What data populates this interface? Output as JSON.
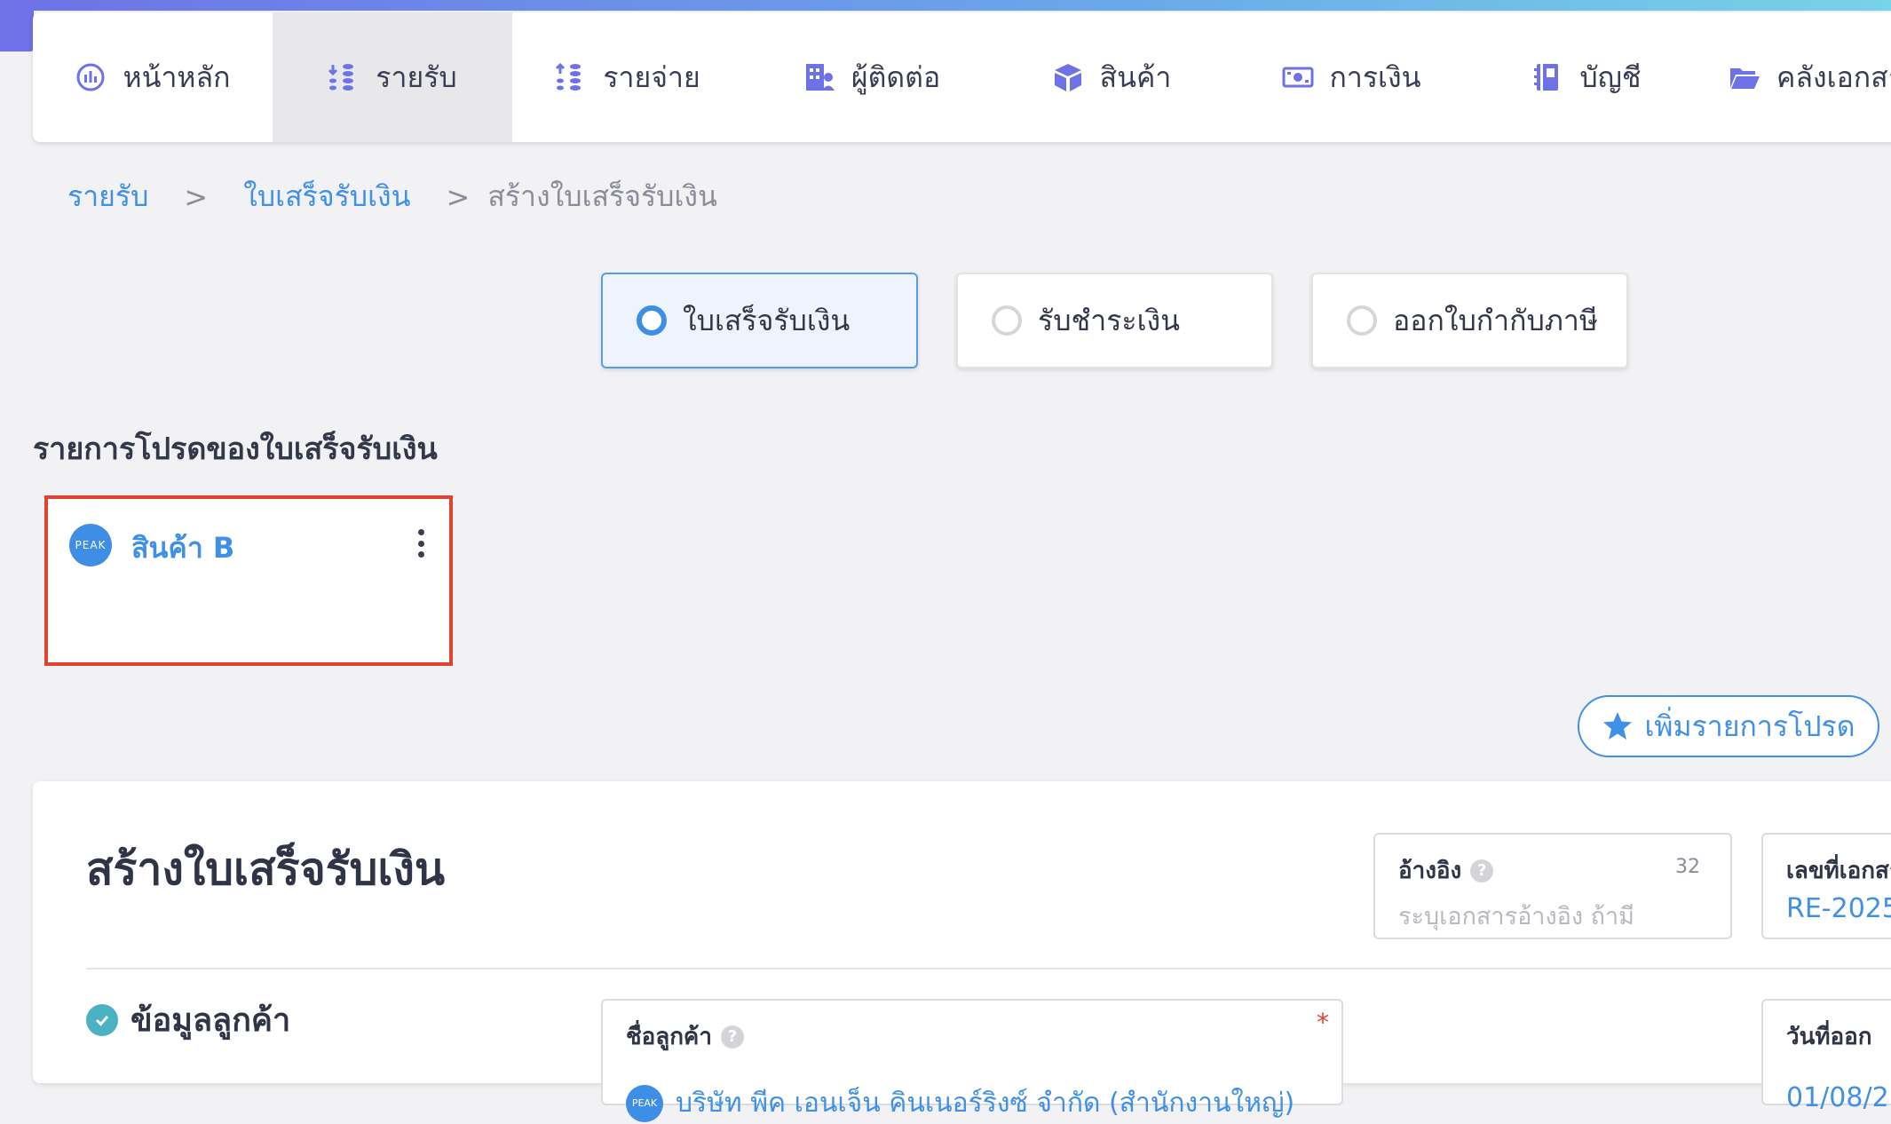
{
  "nav": {
    "items": [
      {
        "label": "หน้าหลัก",
        "icon": "dashboard-icon",
        "active": false
      },
      {
        "label": "รายรับ",
        "icon": "income-icon",
        "active": true
      },
      {
        "label": "รายจ่าย",
        "icon": "expense-icon",
        "active": false
      },
      {
        "label": "ผู้ติดต่อ",
        "icon": "contacts-icon",
        "active": false
      },
      {
        "label": "สินค้า",
        "icon": "box-icon",
        "active": false
      },
      {
        "label": "การเงิน",
        "icon": "money-icon",
        "active": false
      },
      {
        "label": "บัญชี",
        "icon": "ledger-icon",
        "active": false
      },
      {
        "label": "คลังเอกสาร",
        "icon": "folder-icon",
        "active": false
      }
    ]
  },
  "breadcrumb": {
    "level1": "รายรับ",
    "level2": "ใบเสร็จรับเงิน",
    "current": "สร้างใบเสร็จรับเงิน",
    "separator": ">"
  },
  "doc_types": [
    {
      "label": "ใบเสร็จรับเงิน",
      "selected": true
    },
    {
      "label": "รับชำระเงิน",
      "selected": false
    },
    {
      "label": "ออกใบกำกับภาษี",
      "selected": false
    }
  ],
  "favorites": {
    "title": "รายการโปรดของใบเสร็จรับเงิน",
    "card": {
      "avatar_text": "PEAK",
      "name": "สินค้า B"
    },
    "add_button": "เพิ่มรายการโปรด"
  },
  "form": {
    "title": "สร้างใบเสร็จรับเงิน",
    "reference": {
      "label": "อ้างอิง",
      "counter": "32",
      "placeholder": "ระบุเอกสารอ้างอิง ถ้ามี"
    },
    "doc_number": {
      "label": "เลขที่เอกสาร",
      "value": "RE-2025"
    },
    "customer_section": "ข้อมูลลูกค้า",
    "customer_name": {
      "label": "ชื่อลูกค้า",
      "required_mark": "*",
      "avatar_text": "PEAK",
      "value": "บริษัท พีค เอนเจ็น คินเนอร์ริงซ์ จำกัด (สำนักงานใหญ่)"
    },
    "issue_date": {
      "label": "วันที่ออก",
      "value": "01/08/2"
    }
  },
  "colors": {
    "accent": "#3f90e6",
    "highlight": "#e0432e",
    "nav_icon": "#6e72e6"
  }
}
